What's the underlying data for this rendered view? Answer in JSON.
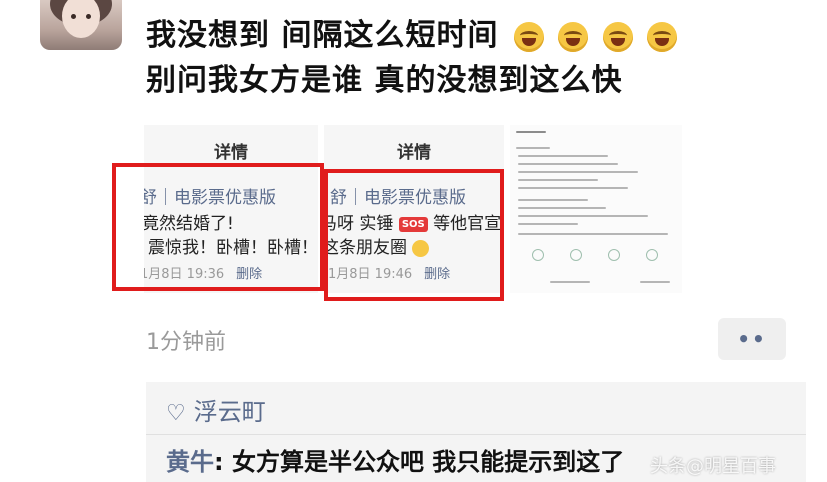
{
  "post": {
    "line1": "我没想到 间隔这么短时间",
    "line1_emoji": [
      "laughing-tears",
      "laughing-tears",
      "laughing-tears",
      "laughing-tears"
    ],
    "line2": "别问我女方是谁 真的没想到这么快"
  },
  "screenshots": [
    {
      "header": "详情",
      "source": "舒｜电影票优惠版",
      "line1": "竟然结婚了!",
      "line2": "震惊我！卧槽！卧槽！",
      "date": "1月8日 19:36",
      "delete": "删除"
    },
    {
      "header": "详情",
      "source": "马呀 实锤",
      "source2": "等他官宣",
      "line1_prefix": "舒｜电影票优惠版",
      "sos": "SOS",
      "line2": "这条朋友圈",
      "date": "1月8日 19:46",
      "delete": "删除"
    }
  ],
  "meta": {
    "time": "1分钟前",
    "more": "••"
  },
  "likes": {
    "names": "浮云町"
  },
  "comment": {
    "author": "黄牛",
    "text": ": 女方算是半公众吧 我只能提示到这了"
  },
  "watermark": "头条@明星百事"
}
